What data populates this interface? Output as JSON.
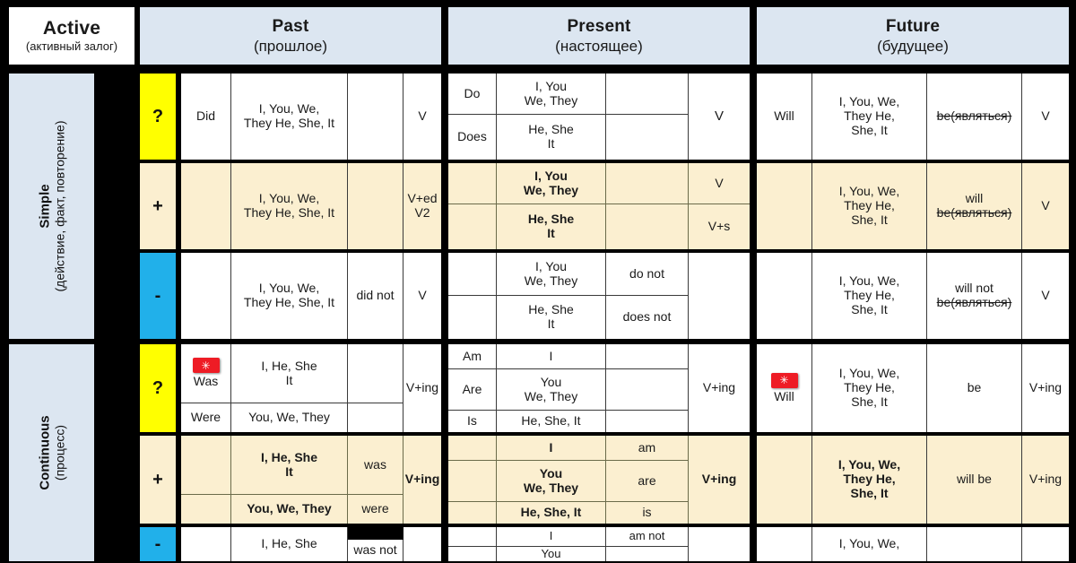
{
  "header": {
    "voice": {
      "en": "Active",
      "ru": "(активный залог)"
    },
    "columns": [
      {
        "en": "Past",
        "ru": "(прошлое)"
      },
      {
        "en": "Present",
        "ru": "(настоящее)"
      },
      {
        "en": "Future",
        "ru": "(будущее)"
      }
    ]
  },
  "aspects": [
    {
      "en": "Simple",
      "ru": "(действие, факт, повторение)"
    },
    {
      "en": "Continuous",
      "ru": "(процесс)"
    }
  ],
  "forms": {
    "question": "?",
    "affirmative": "+",
    "negative": "-"
  },
  "colors": {
    "header_blue": "#dce6f1",
    "cream": "#fbefd0",
    "yellow": "#ffff00",
    "cyan": "#21b0ea",
    "badge_red": "#ee1c25",
    "grid_black": "#000000"
  },
  "icons": {
    "asterisk_badge": "asterisk-badge",
    "badge_glyph": "✳"
  },
  "simple": {
    "past": {
      "question": {
        "aux": "Did",
        "subject": "I, You, We,\nThey He, She, It",
        "aux2": "",
        "verb": "V"
      },
      "affirmative": {
        "aux": "",
        "subject": "I, You, We,\nThey He, She, It",
        "aux2": "",
        "verb": "V+ed\nV2"
      },
      "negative": {
        "aux": "",
        "subject": "I, You, We,\nThey He, She, It",
        "aux2": "did not",
        "verb": "V"
      }
    },
    "present": {
      "question": {
        "rows": [
          {
            "aux": "Do",
            "subject": "I, You\nWe, They",
            "aux2": ""
          },
          {
            "aux": "Does",
            "subject": "He, She\nIt",
            "aux2": ""
          }
        ],
        "verb": "V"
      },
      "affirmative": {
        "rows": [
          {
            "aux": "",
            "subject": "I, You\nWe, They",
            "aux2": "",
            "verb": "V"
          },
          {
            "aux": "",
            "subject": "He, She\nIt",
            "aux2": "",
            "verb": "V+s"
          }
        ]
      },
      "negative": {
        "rows": [
          {
            "aux": "",
            "subject": "I, You\nWe, They",
            "aux2": "do not"
          },
          {
            "aux": "",
            "subject": "He, She\nIt",
            "aux2": "does not"
          }
        ],
        "verb": ""
      }
    },
    "future": {
      "question": {
        "aux": "Will",
        "subject": "I, You, We,\nThey He,\nShe, It",
        "aux2_plain": "",
        "aux2_strike": "be(являться)",
        "verb": "V"
      },
      "affirmative": {
        "aux": "",
        "subject": "I, You, We,\nThey He,\nShe, It",
        "aux2_plain": "will",
        "aux2_strike": "be(являться)",
        "verb": "V"
      },
      "negative": {
        "aux": "",
        "subject": "I, You, We,\nThey He,\nShe, It",
        "aux2_plain": "will not",
        "aux2_strike": "be(являться)",
        "verb": "V"
      }
    }
  },
  "continuous": {
    "past": {
      "question": {
        "rows": [
          {
            "aux": "Was",
            "badge": true,
            "subject": "I, He, She\nIt",
            "aux2": ""
          },
          {
            "aux": "Were",
            "badge": false,
            "subject": "You, We, They",
            "aux2": ""
          }
        ],
        "verb": "V+ing"
      },
      "affirmative": {
        "rows": [
          {
            "aux": "",
            "subject": "I, He, She\nIt",
            "aux2": "was"
          },
          {
            "aux": "",
            "subject": "You, We, They",
            "aux2": "were"
          }
        ],
        "verb": "V+ing"
      },
      "negative": {
        "rows": [
          {
            "aux": "",
            "subject": "I, He, She",
            "aux2": "was not"
          }
        ],
        "verb": ""
      }
    },
    "present": {
      "question": {
        "rows": [
          {
            "aux": "Am",
            "subject": "I",
            "aux2": ""
          },
          {
            "aux": "Are",
            "subject": "You\nWe, They",
            "aux2": ""
          },
          {
            "aux": "Is",
            "subject": "He, She, It",
            "aux2": ""
          }
        ],
        "verb": "V+ing"
      },
      "affirmative": {
        "rows": [
          {
            "aux": "",
            "subject": "I",
            "aux2": "am"
          },
          {
            "aux": "",
            "subject": "You\nWe, They",
            "aux2": "are"
          },
          {
            "aux": "",
            "subject": "He, She, It",
            "aux2": "is"
          }
        ],
        "verb": "V+ing"
      },
      "negative": {
        "rows": [
          {
            "aux": "",
            "subject": "I",
            "aux2": "am not"
          },
          {
            "aux": "",
            "subject": "You",
            "aux2": ""
          }
        ],
        "verb": ""
      }
    },
    "future": {
      "question": {
        "aux": "Will",
        "badge": true,
        "subject": "I, You, We,\nThey He,\nShe, It",
        "aux2": "be",
        "verb": "V+ing"
      },
      "affirmative": {
        "aux": "",
        "badge": false,
        "subject": "I, You, We,\nThey He,\nShe, It",
        "aux2": "will be",
        "verb": "V+ing"
      },
      "negative": {
        "aux": "",
        "badge": false,
        "subject": "I, You, We,",
        "aux2": "",
        "verb": ""
      }
    }
  }
}
